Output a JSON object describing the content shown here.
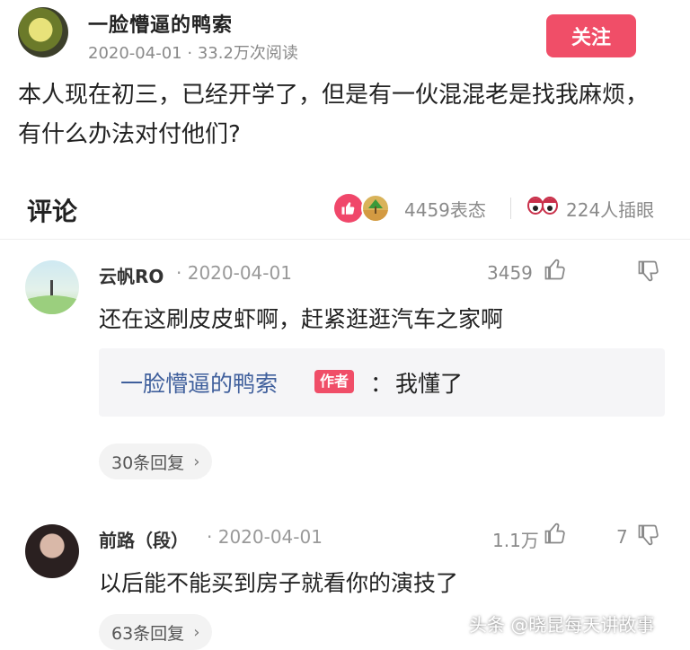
{
  "post": {
    "author": "一脸懵逼的鸭索",
    "date": "2020-04-01",
    "separator": "·",
    "reads": "33.2万次阅读",
    "follow_label": "关注",
    "question": "本人现在初三，已经开学了，但是有一伙混混老是找我麻烦，有什么办法对付他们?"
  },
  "comments_header": {
    "title": "评论",
    "reaction_count": "4459表态",
    "eyes_count": "224人插眼"
  },
  "comments": [
    {
      "name": "云帆RO",
      "separator": "·",
      "date": "2020-04-01",
      "likes": "3459",
      "dislikes": "",
      "text": "还在这刷皮皮虾啊，赶紧逛逛汽车之家啊",
      "reply": {
        "author": "一脸懵逼的鸭索",
        "badge": "作者",
        "colon": "：",
        "text": "我懂了"
      },
      "reply_count": "30条回复"
    },
    {
      "name": "前路（段）",
      "separator": "·",
      "date": "2020-04-01",
      "likes": "1.1万",
      "dislikes": "7",
      "text": "以后能不能买到房子就看你的演技了",
      "reply_count": "63条回复"
    }
  ],
  "watermark": "头条 @晓昆每天讲故事",
  "colors": {
    "accent": "#f04e68",
    "reply_author": "#3f5f9c",
    "muted": "#8a8a8a"
  },
  "icons": [
    "thumbs-up-icon",
    "thumbs-down-icon",
    "chevron-right-icon",
    "eyes-icon"
  ]
}
